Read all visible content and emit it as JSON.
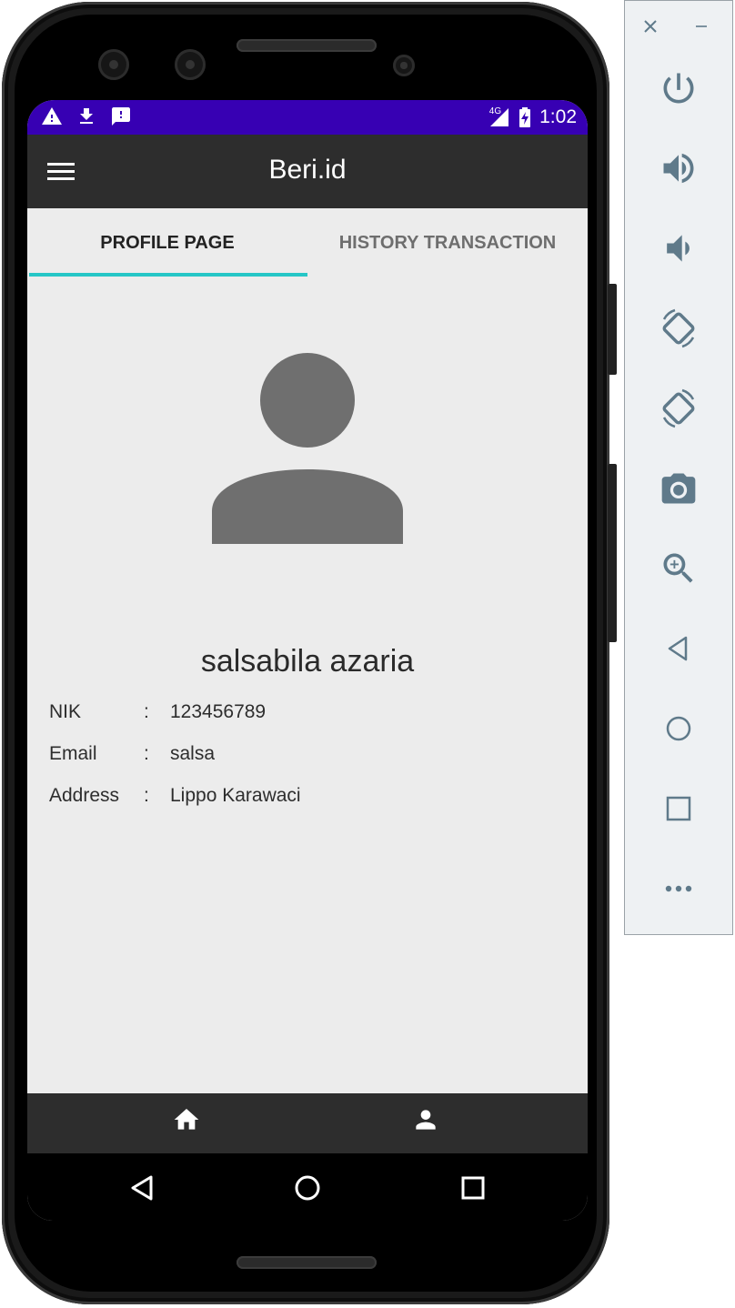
{
  "status_bar": {
    "time": "1:02",
    "network": "4G",
    "left_icons": [
      "warning-icon",
      "download-icon",
      "feedback-icon"
    ],
    "right_icons": [
      "signal-icon",
      "battery-charging-icon"
    ],
    "color": "#3700b3"
  },
  "app_bar": {
    "title": "Beri.id",
    "menu_icon": "hamburger-menu-icon",
    "color": "#2d2d2d"
  },
  "tabs": [
    {
      "label": "PROFILE PAGE",
      "active": true
    },
    {
      "label": "HISTORY TRANSACTION",
      "active": false
    }
  ],
  "tab_indicator_color": "#26c6c6",
  "profile": {
    "avatar_icon": "person-avatar-icon",
    "name": "salsabila azaria",
    "fields": [
      {
        "label": "NIK",
        "colon": ":",
        "value": "123456789"
      },
      {
        "label": "Email",
        "colon": ":",
        "value": "salsa"
      },
      {
        "label": "Address",
        "colon": ":",
        "value": "Lippo Karawaci"
      }
    ]
  },
  "bottom_nav": {
    "items": [
      "home-icon",
      "person-icon"
    ]
  },
  "system_nav": [
    "back-icon",
    "home-circle-icon",
    "recents-icon"
  ],
  "emulator_toolbar": {
    "window_controls": [
      "close-icon",
      "minimize-icon"
    ],
    "buttons": [
      "power-icon",
      "volume-up-icon",
      "volume-down-icon",
      "rotate-left-icon",
      "rotate-right-icon",
      "camera-icon",
      "zoom-icon",
      "back-icon",
      "home-icon",
      "overview-icon",
      "more-icon"
    ],
    "icon_color": "#5f7a8a"
  }
}
